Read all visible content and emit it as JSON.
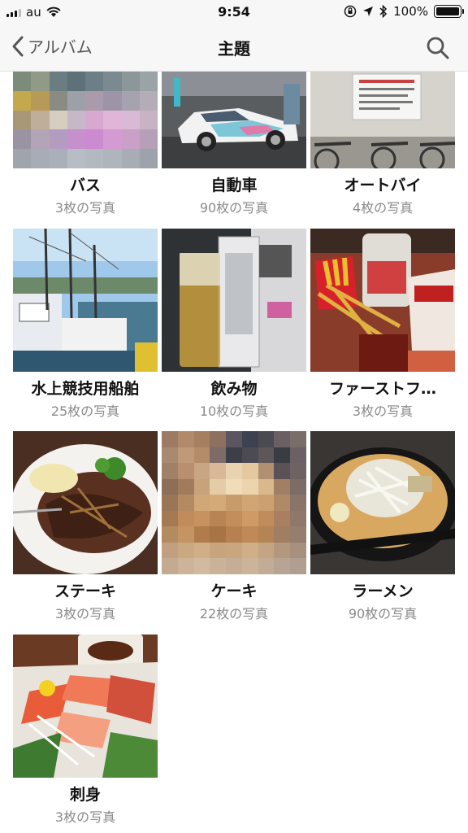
{
  "status_bar": {
    "carrier": "au",
    "time": "9:54",
    "battery": "100%",
    "battery_level": 1.0
  },
  "nav": {
    "back_label": "アルバム",
    "title": "主題"
  },
  "albums": [
    {
      "name": "バス",
      "count": "3枚の写真"
    },
    {
      "name": "自動車",
      "count": "90枚の写真"
    },
    {
      "name": "オートバイ",
      "count": "4枚の写真"
    },
    {
      "name": "水上競技用船舶",
      "count": "25枚の写真"
    },
    {
      "name": "飲み物",
      "count": "10枚の写真"
    },
    {
      "name": "ファーストフ…",
      "count": "3枚の写真"
    },
    {
      "name": "ステーキ",
      "count": "3枚の写真"
    },
    {
      "name": "ケーキ",
      "count": "22枚の写真"
    },
    {
      "name": "ラーメン",
      "count": "90枚の写真"
    },
    {
      "name": "刺身",
      "count": "3枚の写真"
    }
  ],
  "icons": {
    "back": "chevron-left-icon",
    "search": "search-icon",
    "wifi": "wifi-icon",
    "location": "location-arrow-icon",
    "bluetooth": "bluetooth-icon",
    "lock": "orientation-lock-icon"
  }
}
